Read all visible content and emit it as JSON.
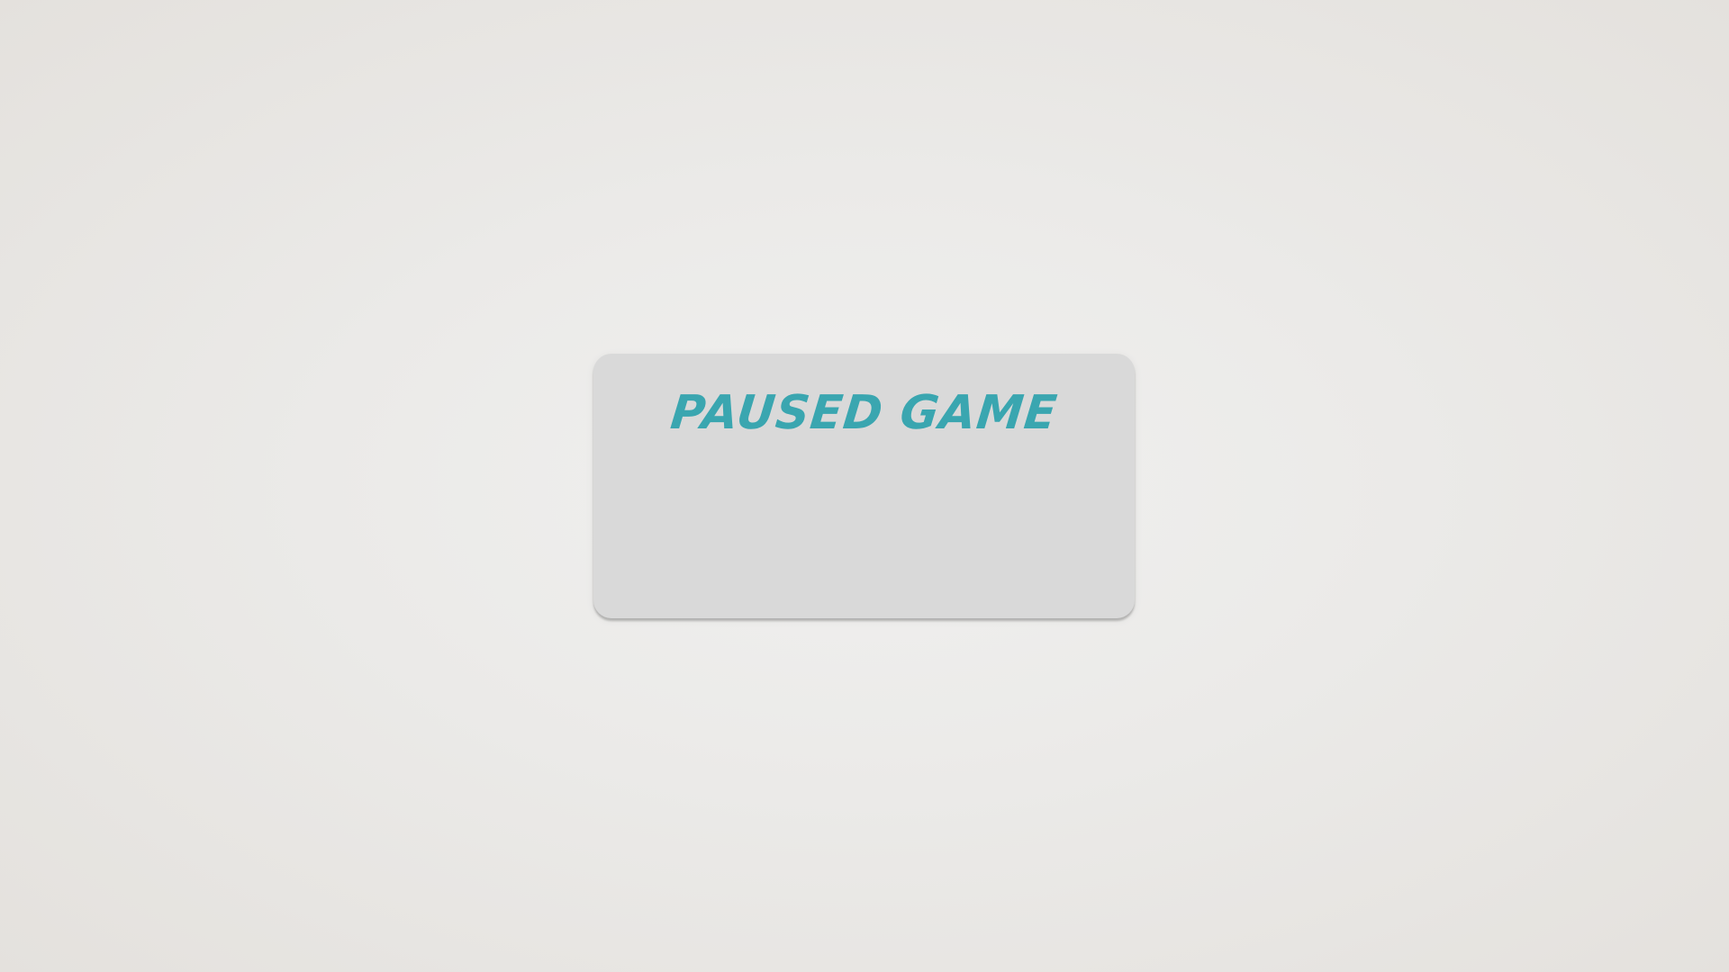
{
  "pause_menu": {
    "title": "PAUSED GAME"
  },
  "colors": {
    "background": "#ebeae8",
    "panel": "#d9d9d9",
    "title": "#3aa6b0"
  }
}
